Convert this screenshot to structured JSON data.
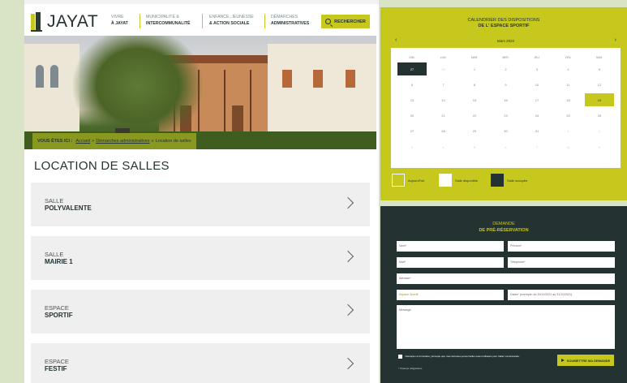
{
  "header": {
    "logo_text": "JAYAT",
    "nav": [
      {
        "top": "VIVRE",
        "bottom": "À JAYAT"
      },
      {
        "top": "MUNICIPALITÉ &",
        "bottom": "INTERCOMMUNALITÉ"
      },
      {
        "top": "ENFANCE, JEUNESSE",
        "bottom": "& ACTION SOCIALE"
      },
      {
        "top": "DÉMARCHES",
        "bottom": "ADMINISTRATIVES"
      }
    ],
    "search_label": "RECHERCHER"
  },
  "breadcrumb": {
    "label": "VOUS ÊTES ICI :",
    "items": [
      "Accueil",
      "Démarches administratives",
      "Location de salles"
    ]
  },
  "page_title": "LOCATION DE SALLES",
  "rooms": [
    {
      "kind": "SALLE",
      "name": "POLYVALENTE"
    },
    {
      "kind": "SALLE",
      "name": "MAIRIE 1"
    },
    {
      "kind": "ESPACE",
      "name": "SPORTIF"
    },
    {
      "kind": "ESPACE",
      "name": "FESTIF"
    }
  ],
  "calendar": {
    "title_line1": "CALENDRIER DES DISPOSITIONS",
    "title_line2": "DE L' ESPACE SPORTIF",
    "month": "Mars 2022",
    "prev": "‹",
    "next": "›",
    "weekdays": [
      "DIM.",
      "LUN.",
      "MAR.",
      "MER.",
      "JEU.",
      "VEN.",
      "SAM."
    ],
    "weeks": [
      [
        "27",
        "28",
        "1",
        "2",
        "3",
        "4",
        "5"
      ],
      [
        "6",
        "7",
        "8",
        "9",
        "10",
        "11",
        "12"
      ],
      [
        "13",
        "14",
        "15",
        "16",
        "17",
        "18",
        "19"
      ],
      [
        "20",
        "21",
        "22",
        "23",
        "24",
        "25",
        "26"
      ],
      [
        "27",
        "28",
        "29",
        "30",
        "31",
        "1",
        "2"
      ],
      [
        "3",
        "4",
        "5",
        "6",
        "7",
        "8",
        "9"
      ]
    ],
    "legend": {
      "today": "Aujourd'hui",
      "available": "Salle disponible",
      "occupied": "Salle occupée"
    }
  },
  "form": {
    "title_line1": "DEMANDE",
    "title_line2": "DE PRÉ-RÉSERVATION",
    "nom": "Nom*",
    "prenom": "Prénom*",
    "mail": "Mail*",
    "telephone": "Téléphone*",
    "adresse": "Adresse*",
    "espace": "Espace Sportif",
    "dates": "Dates* (exemple: du 30/11/2021 au 31/11/2021)",
    "message": "Message",
    "consent": "J'accepte ce formulaire, j'accepte que mes données personnelles soient utilisées pour traiter ma demande.",
    "required_note": "* Champs obligatoires",
    "submit": "SOUMETTRE MA DEMANDE"
  },
  "colors": {
    "accent": "#c6c81e",
    "dark": "#253232",
    "background": "#d9e4c6"
  }
}
